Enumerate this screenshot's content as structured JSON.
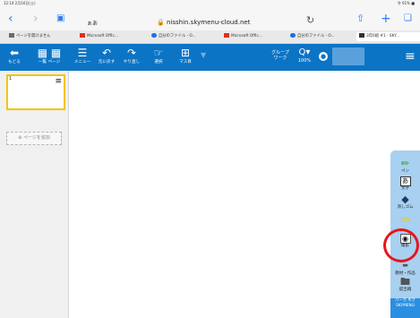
{
  "status_bar": {
    "time": "12:14 2月16日(土)",
    "right": "令 91% ■"
  },
  "browser": {
    "aa": "ぁあ",
    "url": "nisshin.skymenu-cloud.net",
    "tabs": [
      {
        "label": "ページを開けません",
        "color": "#6a6a6a"
      },
      {
        "label": "Microsoft Offic...",
        "color": "#e0301e"
      },
      {
        "label": "自分のファイル - O...",
        "color": "#1a73e8"
      },
      {
        "label": "Microsoft Offic...",
        "color": "#e0301e"
      },
      {
        "label": "自分のファイル - O...",
        "color": "#1a73e8"
      },
      {
        "label": "3年6組 #1 · SKY...",
        "color": "#333333"
      }
    ]
  },
  "toolbar": {
    "back": "もどる",
    "page": "一覧 ページ",
    "menu": "メニュー",
    "undo": "元に戻す",
    "redo": "やり直し",
    "select": "選択",
    "grid": "マス目",
    "group": "グループ ワーク",
    "zoom": "100%"
  },
  "sidebar": {
    "thumb_number": "1",
    "add_page": "ページを追加"
  },
  "right_tools": {
    "pen": "ペン",
    "text": "文字",
    "eraser": "消しゴム",
    "folder1": "",
    "camera": "撮影",
    "save": "教材・作品",
    "submit": "提出箱",
    "brand": "パーカ ゆき SKYMENU"
  },
  "accent": {
    "toolbar": "#0c74c4",
    "highlight": "#e8141a",
    "thumb_border": "#f2c500"
  }
}
